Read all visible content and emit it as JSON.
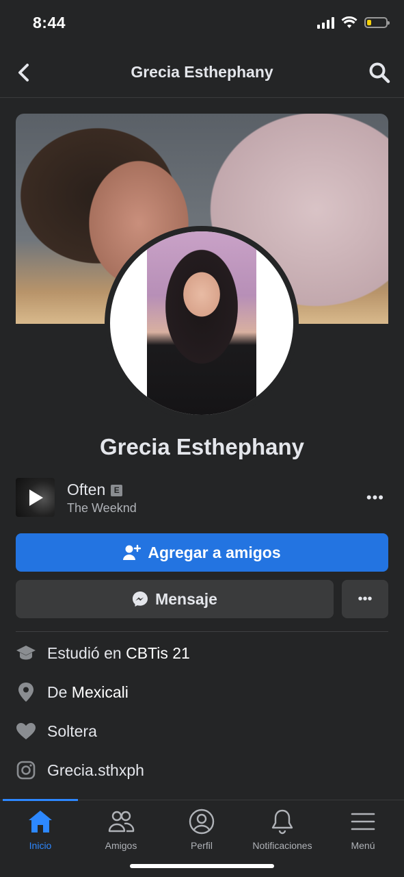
{
  "status": {
    "time": "8:44",
    "battery_color": "#f5d10a"
  },
  "nav": {
    "title": "Grecia Esthephany",
    "back_icon": "chevron-left-icon",
    "search_icon": "search-icon"
  },
  "profile": {
    "name": "Grecia Esthephany"
  },
  "music": {
    "title": "Often",
    "explicit": "E",
    "artist": "The Weeknd",
    "more": "•••"
  },
  "actions": {
    "add_friend": "Agregar a amigos",
    "message": "Mensaje",
    "more": "•••",
    "accent": "#2374e1"
  },
  "intro": {
    "studied_prefix": "Estudió en ",
    "studied_value": "CBTis 21",
    "from_prefix": "De ",
    "from_value": "Mexicali",
    "relationship": "Soltera",
    "instagram": "Grecia.sthxph"
  },
  "tabs": [
    {
      "label": "Inicio",
      "icon": "home-icon",
      "active": true
    },
    {
      "label": "Amigos",
      "icon": "friends-icon",
      "active": false
    },
    {
      "label": "Perfil",
      "icon": "profile-icon",
      "active": false
    },
    {
      "label": "Notificaciones",
      "icon": "bell-icon",
      "active": false
    },
    {
      "label": "Menú",
      "icon": "hamburger-icon",
      "active": false
    }
  ]
}
